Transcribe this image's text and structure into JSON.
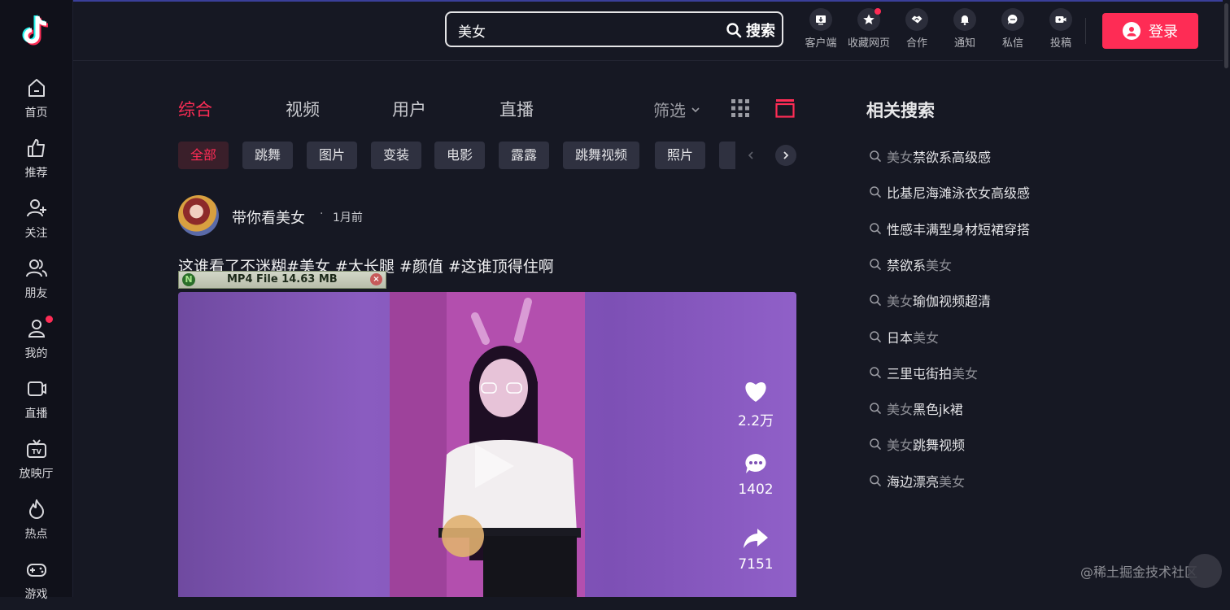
{
  "sidebar": {
    "items": [
      {
        "label": "首页",
        "icon": "home-icon"
      },
      {
        "label": "推荐",
        "icon": "thumb-up-icon"
      },
      {
        "label": "关注",
        "icon": "follow-icon"
      },
      {
        "label": "朋友",
        "icon": "friends-icon"
      },
      {
        "label": "我的",
        "icon": "profile-icon"
      },
      {
        "label": "直播",
        "icon": "live-icon"
      },
      {
        "label": "放映厅",
        "icon": "tv-icon"
      },
      {
        "label": "热点",
        "icon": "flame-icon"
      },
      {
        "label": "游戏",
        "icon": "gamepad-icon"
      }
    ]
  },
  "header": {
    "search_value": "美女",
    "search_button": "搜索",
    "items": [
      {
        "label": "客户端",
        "icon": "download-icon"
      },
      {
        "label": "收藏网页",
        "icon": "star-icon"
      },
      {
        "label": "合作",
        "icon": "handshake-icon"
      },
      {
        "label": "通知",
        "icon": "bell-icon"
      },
      {
        "label": "私信",
        "icon": "message-icon"
      },
      {
        "label": "投稿",
        "icon": "upload-video-icon"
      }
    ],
    "login": "登录"
  },
  "tabs": [
    "综合",
    "视频",
    "用户",
    "直播"
  ],
  "filter": "筛选",
  "chips": [
    "全部",
    "跳舞",
    "图片",
    "变装",
    "电影",
    "露露",
    "跳舞视频",
    "照片"
  ],
  "post": {
    "author": "带你看美女",
    "dot": "·",
    "time": "1月前",
    "description": "这谁看了不迷糊#美女 #大长腿 #颜值 #这谁顶得住啊",
    "download_bar": {
      "badge": "N",
      "text": "MP4 File 14.63 MB",
      "close": "×"
    },
    "likes": "2.2万",
    "comments": "1402",
    "shares": "7151"
  },
  "related": {
    "title": "相关搜索",
    "items": [
      [
        {
          "t": "美女",
          "hl": true
        },
        {
          "t": "禁欲系高级感",
          "hl": false
        }
      ],
      [
        {
          "t": "比基尼海滩泳衣女高级感",
          "hl": false
        }
      ],
      [
        {
          "t": "性感丰满型身材短裙穿搭",
          "hl": false
        }
      ],
      [
        {
          "t": "禁欲系",
          "hl": false
        },
        {
          "t": "美女",
          "hl": true
        }
      ],
      [
        {
          "t": "美女",
          "hl": true
        },
        {
          "t": "瑜伽视频超清",
          "hl": false
        }
      ],
      [
        {
          "t": "日本",
          "hl": false
        },
        {
          "t": "美女",
          "hl": true
        }
      ],
      [
        {
          "t": "三里屯街拍",
          "hl": false
        },
        {
          "t": "美女",
          "hl": true
        }
      ],
      [
        {
          "t": "美女",
          "hl": true
        },
        {
          "t": "黑色jk裙",
          "hl": false
        }
      ],
      [
        {
          "t": "美女",
          "hl": true
        },
        {
          "t": "跳舞视频",
          "hl": false
        }
      ],
      [
        {
          "t": "海边漂亮",
          "hl": false
        },
        {
          "t": "美女",
          "hl": true
        }
      ]
    ]
  },
  "watermark": "@稀土掘金技术社区",
  "colors": {
    "accent": "#fe2c55",
    "background": "#161823",
    "sidebar": "#10111a"
  }
}
